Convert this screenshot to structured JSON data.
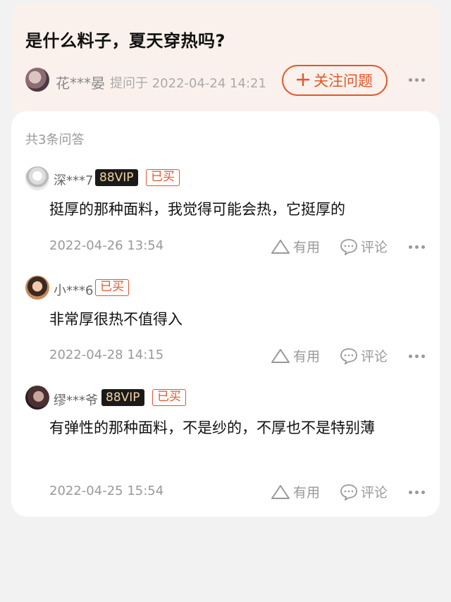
{
  "question": {
    "title": "是什么料子，夏天穿热吗?",
    "asker_name": "花***晏",
    "asker_meta": "提问于 2022-04-24 14:21",
    "follow_label": "关注问题",
    "follow_icon": "plus-icon",
    "more_icon": "more-dots-icon"
  },
  "answers_count": "共3条问答",
  "answers": [
    {
      "name": "深***7",
      "vip_label": "88VIP",
      "bought_label": "已买",
      "text": "挺厚的那种面料，我觉得可能会热，它挺厚的",
      "date": "2022-04-26 13:54",
      "useful_label": "有用",
      "comment_label": "评论"
    },
    {
      "name": "小***6",
      "bought_label": "已买",
      "text": "非常厚很热不值得入",
      "date": "2022-04-28 14:15",
      "useful_label": "有用",
      "comment_label": "评论"
    },
    {
      "name": "缪***爷",
      "vip_label": "88VIP",
      "bought_label": "已买",
      "text": "有弹性的那种面料，不是纱的，不厚也不是特别薄",
      "date": "2022-04-25 15:54",
      "useful_label": "有用",
      "comment_label": "评论"
    }
  ],
  "colors": {
    "accent": "#e2562b",
    "question_bg": "#fbf1ec",
    "vip_bg": "#1a1a1a",
    "vip_text": "#f2d3a0"
  }
}
